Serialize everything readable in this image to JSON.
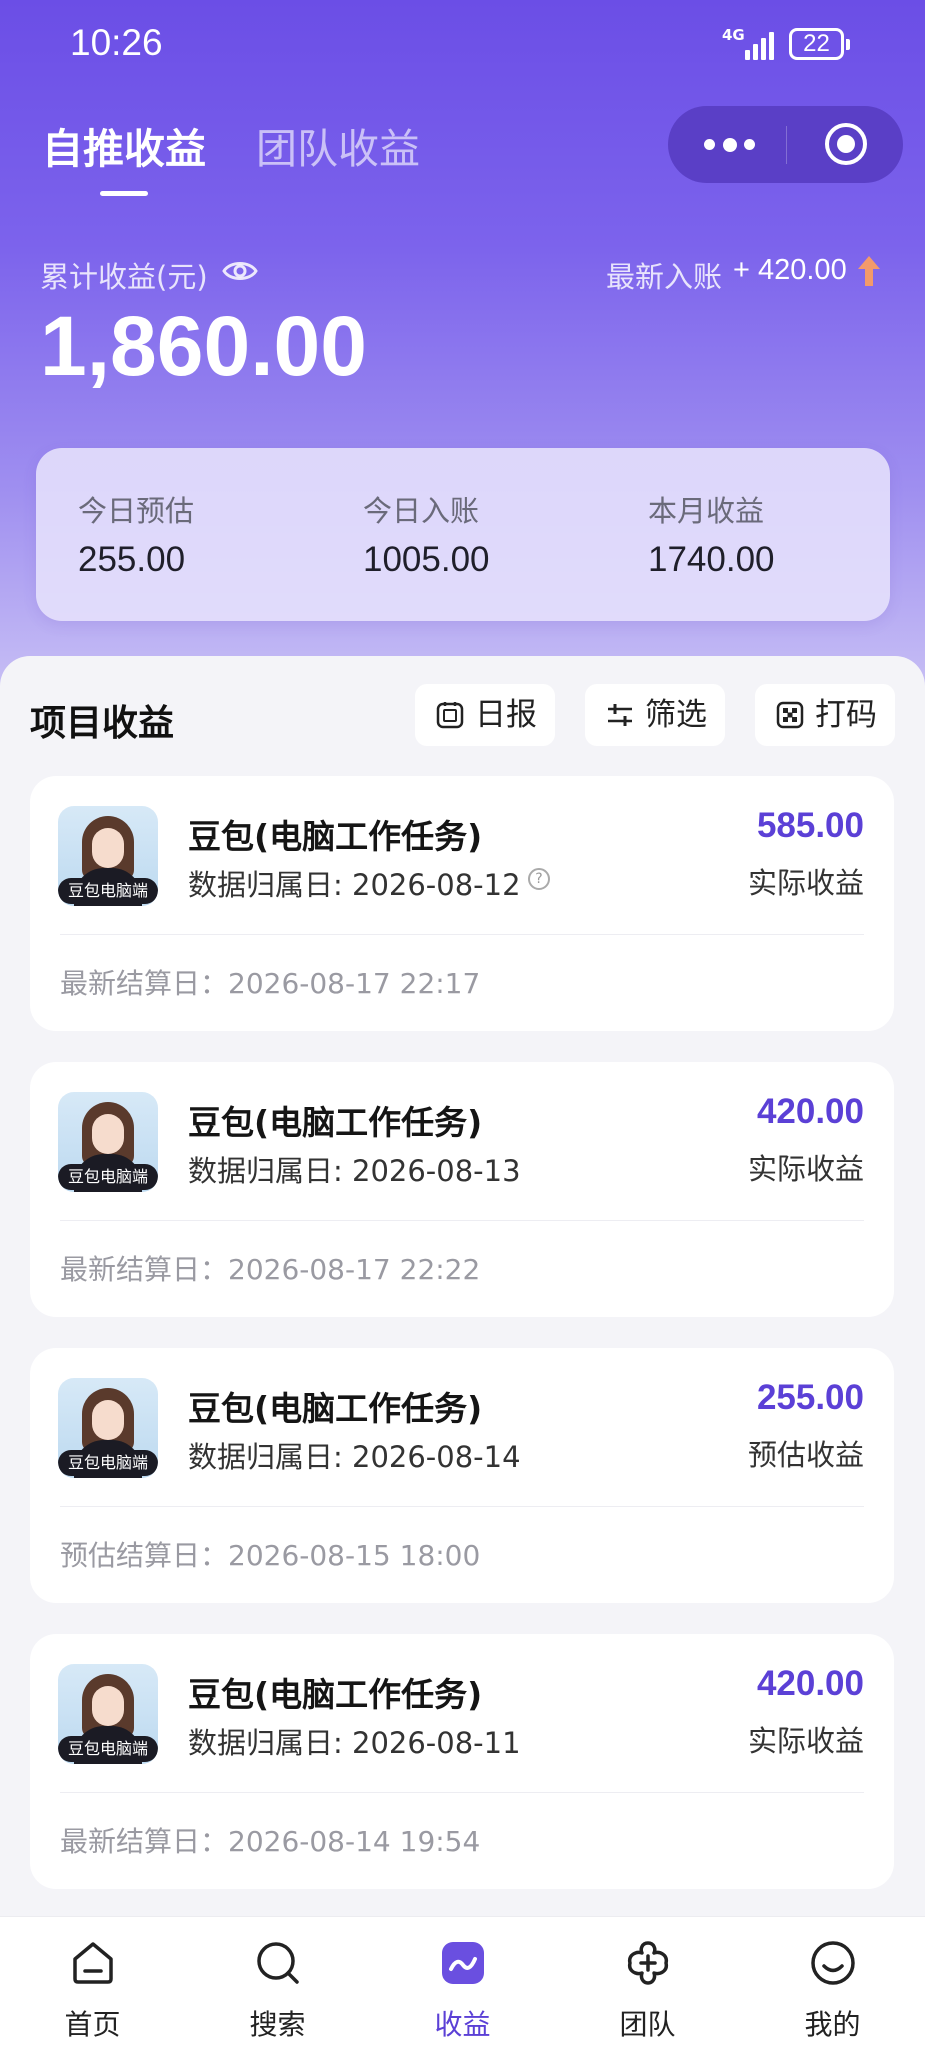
{
  "status_bar": {
    "time": "10:26",
    "network": "4G",
    "battery": "22"
  },
  "header": {
    "tabs": [
      {
        "label": "自推收益"
      },
      {
        "label": "团队收益"
      }
    ]
  },
  "earnings": {
    "cumulative_label": "累计收益(元)",
    "cumulative_value": "1,860.00",
    "latest_label": "最新入账",
    "latest_amount": "+ 420.00"
  },
  "stats": [
    {
      "label": "今日预估",
      "value": "255.00"
    },
    {
      "label": "今日入账",
      "value": "1005.00"
    },
    {
      "label": "本月收益",
      "value": "1740.00"
    }
  ],
  "projects": {
    "title": "项目收益",
    "buttons": [
      {
        "label": "日报",
        "icon": "daily-report-icon"
      },
      {
        "label": "筛选",
        "icon": "filter-icon"
      },
      {
        "label": "打码",
        "icon": "mosaic-icon"
      }
    ],
    "items": [
      {
        "avatar_tag": "豆包电脑端",
        "title": "豆包(电脑工作任务)",
        "date": "数据归属日: 2026-08-12",
        "amount": "585.00",
        "amount_type": "实际收益",
        "settle": "最新结算日：2026-08-17 22:17"
      },
      {
        "avatar_tag": "豆包电脑端",
        "title": "豆包(电脑工作任务)",
        "date": "数据归属日: 2026-08-13",
        "amount": "420.00",
        "amount_type": "实际收益",
        "settle": "最新结算日：2026-08-17 22:22"
      },
      {
        "avatar_tag": "豆包电脑端",
        "title": "豆包(电脑工作任务)",
        "date": "数据归属日: 2026-08-14",
        "amount": "255.00",
        "amount_type": "预估收益",
        "settle": "预估结算日：2026-08-15 18:00"
      },
      {
        "avatar_tag": "豆包电脑端",
        "title": "豆包(电脑工作任务)",
        "date": "数据归属日: 2026-08-11",
        "amount": "420.00",
        "amount_type": "实际收益",
        "settle": "最新结算日：2026-08-14 19:54"
      }
    ]
  },
  "bottom_nav": [
    {
      "label": "首页",
      "icon": "home-icon"
    },
    {
      "label": "搜索",
      "icon": "search-icon"
    },
    {
      "label": "收益",
      "icon": "earnings-icon",
      "active": true
    },
    {
      "label": "团队",
      "icon": "team-icon"
    },
    {
      "label": "我的",
      "icon": "profile-icon"
    }
  ],
  "colors": {
    "accent": "#5b40d6",
    "hero_top": "#6b4ee6",
    "hero_bottom": "#c9c1f5"
  }
}
